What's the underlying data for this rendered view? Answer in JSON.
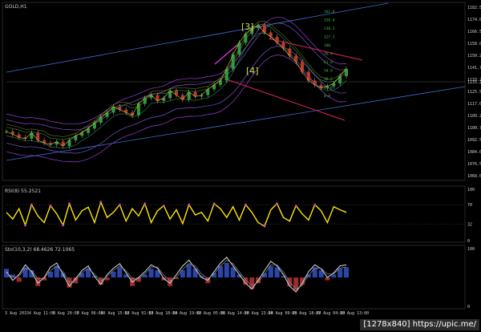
{
  "window": {
    "symbol_label": "GOLD,H1"
  },
  "chart_data": [
    {
      "type": "line",
      "title": "GOLD,H1",
      "ylim": [
        1063,
        1182
      ],
      "y_ticks": [
        "1182.50",
        "1174.00",
        "1166.50",
        "1158.00",
        "1150.25",
        "1141.75",
        "1133.25",
        "1125.50",
        "1117.00",
        "1109.25",
        "1100.75",
        "1092.50",
        "1084.00",
        "1076.50",
        "1068.00"
      ],
      "current_price": "1133.25",
      "x_labels": [
        "3 Aug 2015",
        "4 Aug 11:00",
        "5 Aug 20:00",
        "7 Aug 06:00",
        "10 Aug 15:00",
        "12 Aug 01:00",
        "13 Aug 10:00",
        "14 Aug 19:00",
        "18 Aug 05:00",
        "19 Aug 14:00",
        "20 Aug 23:00",
        "24 Aug 09:00",
        "25 Aug 18:00",
        "27 Aug 04:00",
        "28 Aug 13:00"
      ],
      "annotations": [
        "[3]",
        "[4]"
      ],
      "levels": [
        "161.8",
        "150.0",
        "138.2",
        "127.2",
        "100",
        "76.4",
        "61.8",
        "50.0",
        "38.2",
        "23.6",
        "0.0"
      ],
      "series": [
        {
          "values": [
            1095,
            1093,
            1091,
            1090,
            1094,
            1089,
            1087,
            1086,
            1088,
            1085,
            1089,
            1092,
            1094,
            1097,
            1101,
            1105,
            1108,
            1112,
            1110,
            1108,
            1106,
            1114,
            1118,
            1120,
            1116,
            1118,
            1123,
            1120,
            1117,
            1122,
            1119,
            1120,
            1124,
            1127,
            1130,
            1138,
            1148,
            1156,
            1162,
            1166,
            1168,
            1163,
            1160,
            1156,
            1152,
            1147,
            1143,
            1136,
            1130,
            1127,
            1125,
            1126,
            1128,
            1133,
            1138
          ]
        }
      ]
    },
    {
      "type": "line",
      "title": "RSI(8) 55.2521",
      "ylim": [
        0,
        100
      ],
      "y_ticks": [
        "100",
        "70",
        "32",
        "0"
      ],
      "series": [
        {
          "values": [
            55,
            42,
            62,
            30,
            70,
            48,
            35,
            68,
            52,
            30,
            72,
            40,
            58,
            65,
            35,
            75,
            45,
            55,
            70,
            38,
            62,
            48,
            72,
            35,
            58,
            68,
            42,
            60,
            33,
            70,
            50,
            55,
            38,
            72,
            62,
            45,
            66,
            40,
            70,
            55,
            35,
            28,
            60,
            72,
            45,
            38,
            68,
            52,
            40,
            70,
            58,
            35,
            66,
            60,
            55
          ]
        }
      ]
    },
    {
      "type": "line",
      "title": "Sto(10,3,2) 68.4626 72.1065",
      "ylim": [
        0,
        100
      ],
      "y_ticks": [
        "100",
        "0"
      ],
      "series": [
        {
          "values": [
            60,
            45,
            55,
            72,
            60,
            40,
            50,
            68,
            75,
            55,
            35,
            48,
            62,
            70,
            52,
            38,
            55,
            66,
            74,
            58,
            42,
            50,
            60,
            72,
            66,
            48,
            40,
            55,
            70,
            80,
            65,
            50,
            45,
            60,
            75,
            85,
            70,
            55,
            40,
            30,
            45,
            62,
            78,
            70,
            55,
            35,
            25,
            40,
            60,
            72,
            65,
            50,
            58,
            70,
            72
          ]
        },
        {
          "values": [
            58,
            50,
            52,
            66,
            62,
            48,
            48,
            62,
            70,
            60,
            42,
            45,
            58,
            66,
            56,
            44,
            52,
            62,
            70,
            62,
            48,
            48,
            56,
            68,
            68,
            54,
            44,
            50,
            64,
            74,
            70,
            56,
            48,
            56,
            70,
            80,
            74,
            60,
            46,
            36,
            42,
            56,
            72,
            72,
            60,
            42,
            30,
            36,
            54,
            66,
            66,
            56,
            56,
            66,
            68
          ]
        }
      ],
      "histogram": [
        0.6,
        0.2,
        -0.3,
        0.7,
        0.5,
        -0.6,
        -0.2,
        0.4,
        0.8,
        0.3,
        -0.7,
        -0.4,
        0.3,
        0.6,
        0.1,
        -0.5,
        -0.2,
        0.4,
        0.7,
        0.2,
        -0.6,
        -0.3,
        0.2,
        0.6,
        0.5,
        -0.2,
        -0.6,
        -0.1,
        0.5,
        0.9,
        0.6,
        0.1,
        -0.4,
        0.3,
        0.8,
        1.0,
        0.7,
        0.2,
        -0.5,
        -0.8,
        -0.4,
        0.3,
        0.8,
        0.7,
        0.1,
        -0.6,
        -0.9,
        -0.5,
        0.2,
        0.7,
        0.5,
        -0.2,
        0.2,
        0.6,
        0.7
      ]
    }
  ],
  "footer": {
    "watermark": "[1278x840] https://upic.me/"
  }
}
